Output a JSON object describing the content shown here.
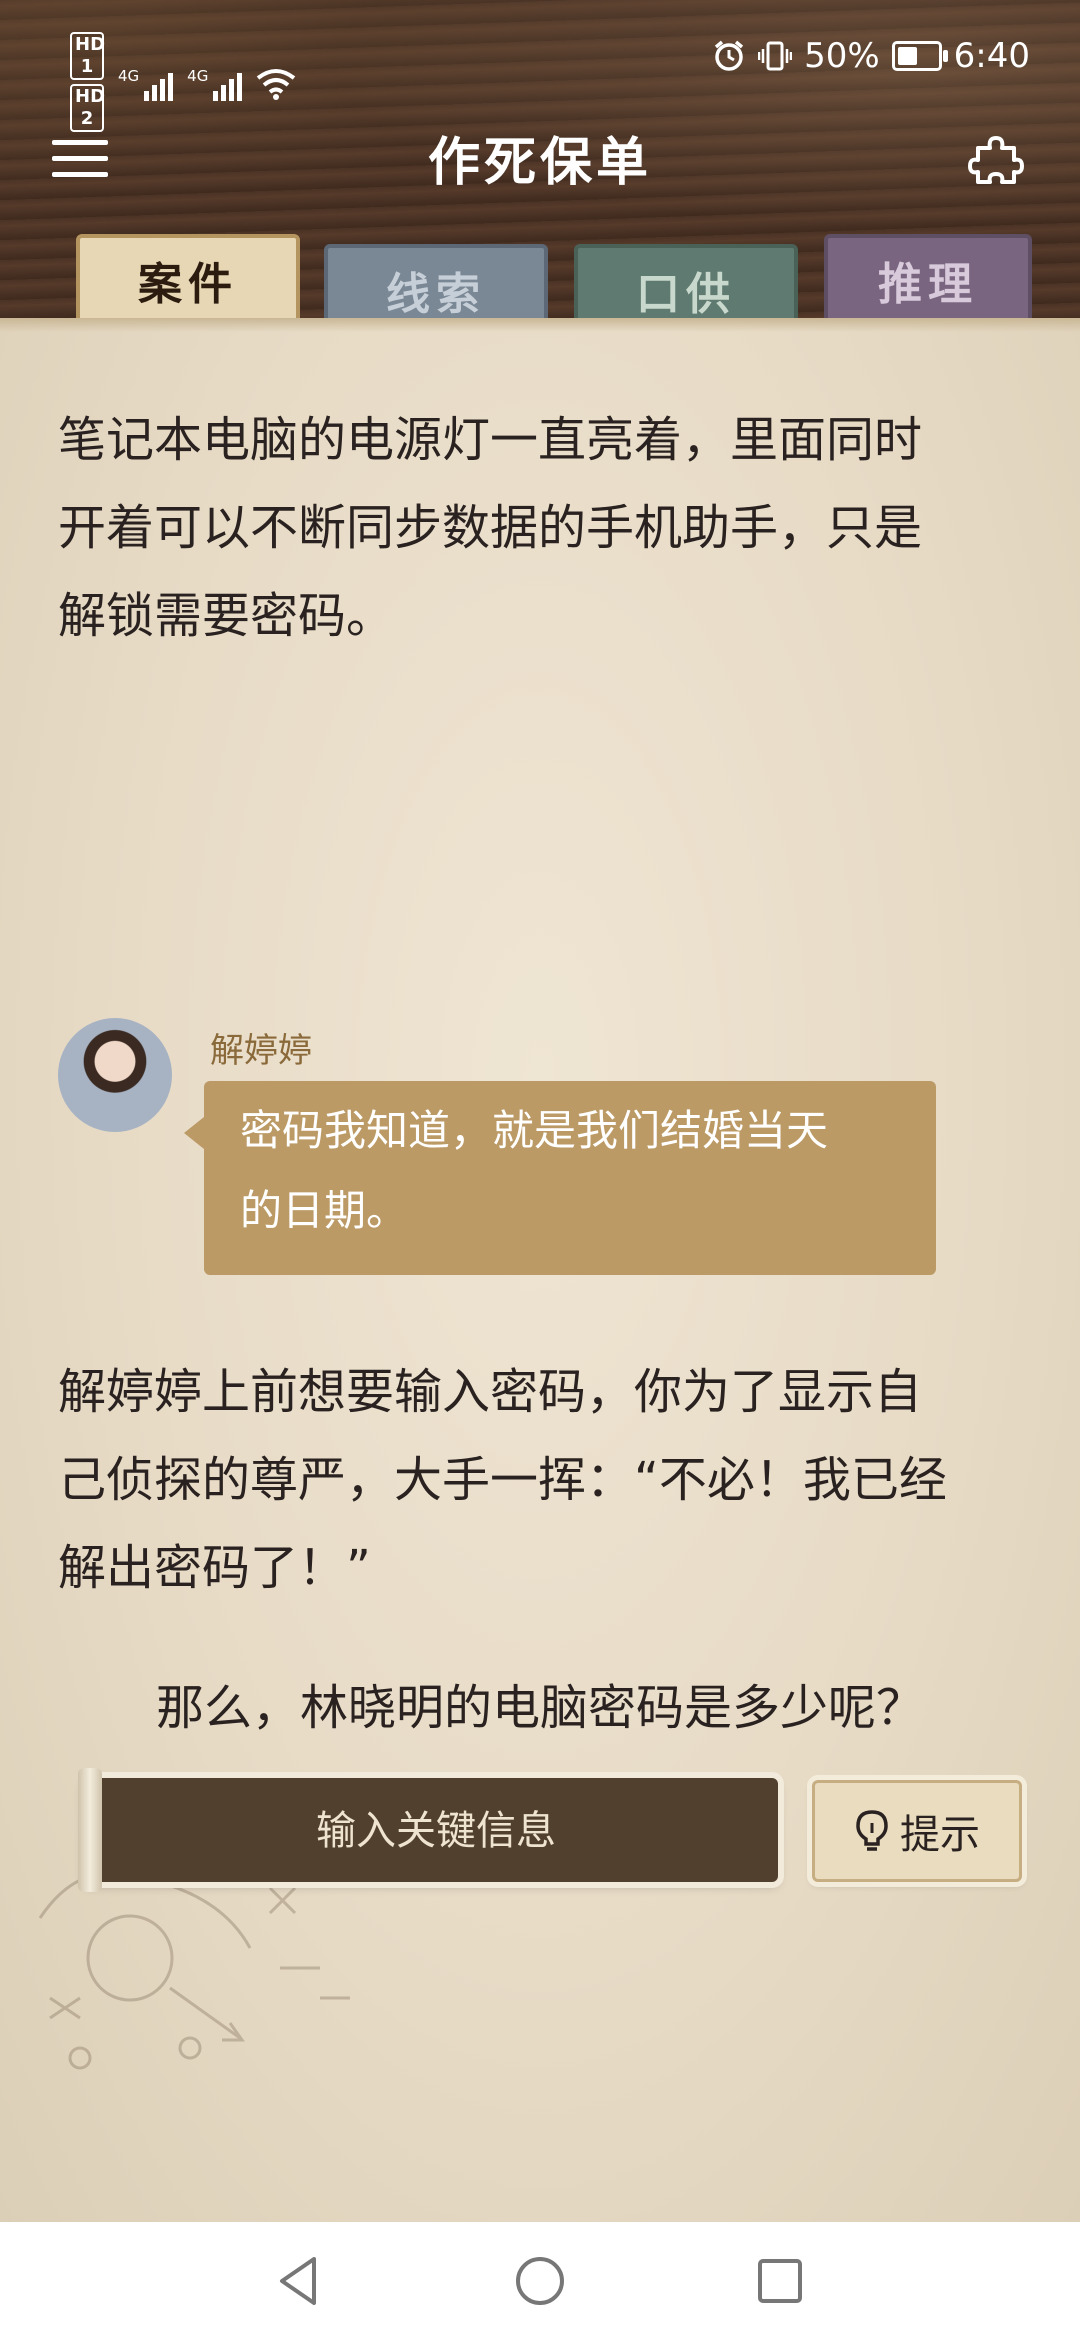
{
  "status_bar": {
    "sim1": "HD 1",
    "sim2": "HD 2",
    "network1": "4G",
    "network2": "4G",
    "battery_percent": "50%",
    "battery_level": 0.5,
    "time": "6:40"
  },
  "header": {
    "title": "作死保单",
    "menu_icon": "hamburger-menu-icon",
    "right_icon": "puzzle-icon"
  },
  "tabs": [
    {
      "label": "案件",
      "active": true
    },
    {
      "label": "线索",
      "active": false
    },
    {
      "label": "口供",
      "active": false
    },
    {
      "label": "推理",
      "active": false
    }
  ],
  "content": {
    "paragraph1": [
      "笔记本电脑的电源灯一直亮着，里面同时",
      "开着可以不断同步数据的手机助手，只是",
      "解锁需要密码。"
    ],
    "speaker_name": "解婷婷",
    "dialogue": [
      "密码我知道，就是我们结婚当天",
      "的日期。"
    ],
    "paragraph2": [
      "解婷婷上前想要输入密码，你为了显示自",
      "己侦探的尊严，大手一挥：“不必！我已经",
      "解出密码了！”"
    ],
    "question": "那么，林晓明的电脑密码是多少呢？"
  },
  "input": {
    "placeholder": "输入关键信息",
    "value": ""
  },
  "hint_button": {
    "label": "提示",
    "icon": "lightbulb-icon"
  },
  "navigation_bar": {
    "back_icon": "back-triangle-icon",
    "home_icon": "home-circle-icon",
    "recents_icon": "recents-square-icon"
  },
  "colors": {
    "bubble": "#bc9a66",
    "paper": "#e7dbc6",
    "header_wood": "#4a3224",
    "speaker_name": "#8a6a3a"
  }
}
